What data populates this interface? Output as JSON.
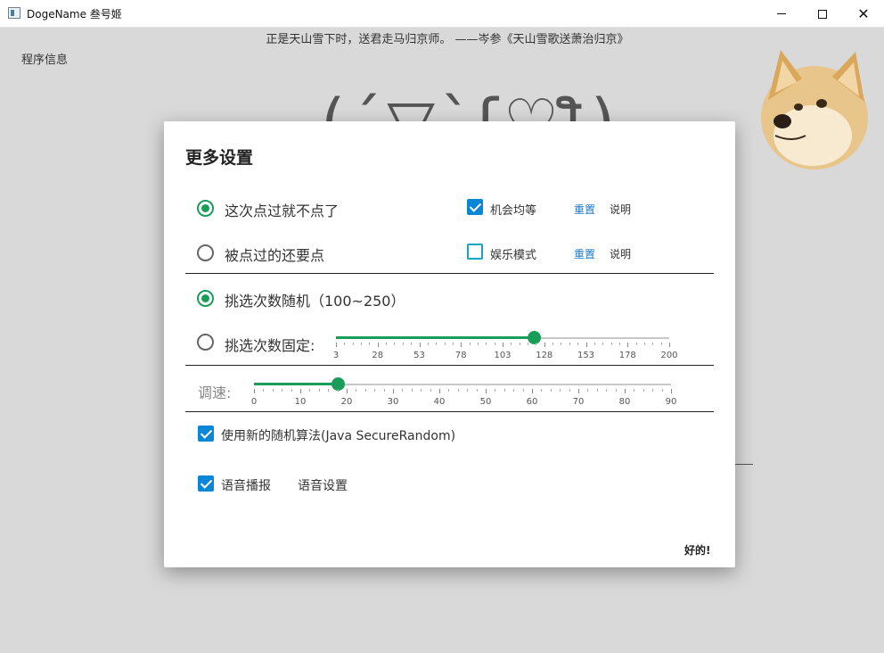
{
  "window": {
    "title": "DogeName 叁号姬"
  },
  "background": {
    "poem": "正是天山雪下时，送君走马归京师。 ——岑参《天山雪歌送萧治归京》",
    "program_info": "程序信息",
    "big_face": "(´▽`ʃ♡ƪ)"
  },
  "dialog": {
    "title": "更多设置",
    "options": {
      "no_repeat": "这次点过就不点了",
      "allow_repeat": "被点过的还要点",
      "random_count": "挑选次数随机（100~250）",
      "fixed_count": "挑选次数固定:",
      "speed": "调速:",
      "new_algo": "使用新的随机算法(Java SecureRandom)",
      "voice": "语音播报",
      "voice_settings": "语音设置"
    },
    "toggles": {
      "equal_chance": "机会均等",
      "fun_mode": "娱乐模式",
      "reset": "重置",
      "explain": "说明"
    },
    "fixed_slider": {
      "min": 3,
      "max": 200,
      "value": 120,
      "tick_labels": [
        "3",
        "28",
        "53",
        "78",
        "103",
        "128",
        "153",
        "178",
        "200"
      ]
    },
    "speed_slider": {
      "min": 0,
      "max": 100,
      "value": 20,
      "tick_labels": [
        "0",
        "10",
        "20",
        "30",
        "40",
        "50",
        "60",
        "70",
        "80",
        "90"
      ]
    },
    "ok": "好的!"
  },
  "colors": {
    "accent_green": "#1b9d5a",
    "check_blue": "#0a86d6",
    "link_blue": "#1d78c8"
  },
  "icons": {
    "app": "app-window-icon",
    "minimize": "minimize-icon",
    "maximize": "maximize-icon",
    "close": "close-icon",
    "doge": "doge-image"
  }
}
